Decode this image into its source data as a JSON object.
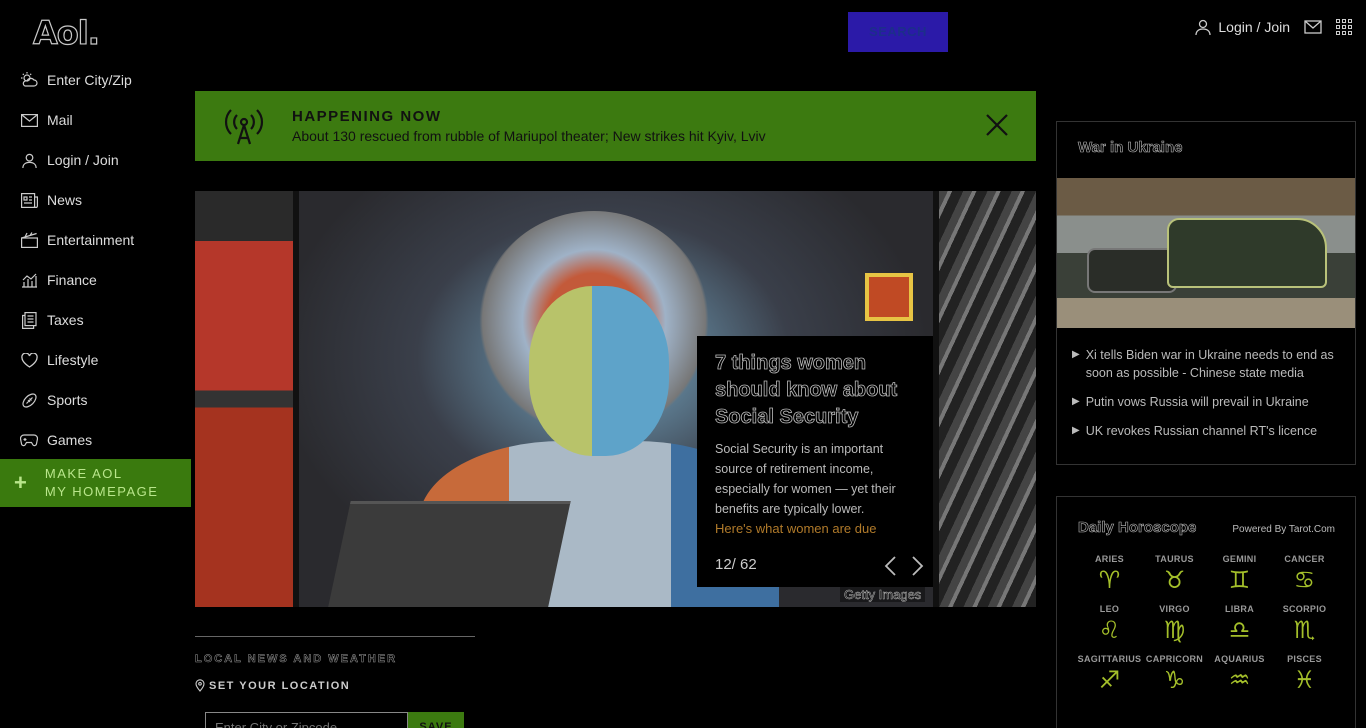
{
  "header": {
    "logo": "Aol.",
    "search_label": "SEARCH",
    "login_label": "Login / Join"
  },
  "sidebar": {
    "items": [
      {
        "label": "Enter City/Zip",
        "icon": "weather-icon"
      },
      {
        "label": "Mail",
        "icon": "mail-icon"
      },
      {
        "label": "Login / Join",
        "icon": "user-icon"
      },
      {
        "label": "News",
        "icon": "news-icon"
      },
      {
        "label": "Entertainment",
        "icon": "clapper-icon"
      },
      {
        "label": "Finance",
        "icon": "chart-icon"
      },
      {
        "label": "Taxes",
        "icon": "document-icon"
      },
      {
        "label": "Lifestyle",
        "icon": "heart-icon"
      },
      {
        "label": "Sports",
        "icon": "football-icon"
      },
      {
        "label": "Games",
        "icon": "gamepad-icon"
      }
    ],
    "make_homepage_line1": "MAKE AOL",
    "make_homepage_line2": "MY HOMEPAGE"
  },
  "happening": {
    "title": "HAPPENING NOW",
    "text": "About 130 rescued from rubble of Mariupol theater; New strikes hit Kyiv, Lviv"
  },
  "slide": {
    "headline": "7 things women should know about Social Security",
    "description": "Social Security is an important source of retirement income, especially for women — yet their benefits are typically lower.",
    "more_link": "Here's what women are due",
    "counter": "12/ 62",
    "credit": "Getty Images"
  },
  "local": {
    "title": "LOCAL NEWS AND WEATHER",
    "set_location": "SET YOUR LOCATION",
    "input_placeholder": "Enter City or Zipcode",
    "save_label": "SAVE"
  },
  "ukraine": {
    "title": "War in Ukraine",
    "items": [
      "Xi tells Biden war in Ukraine needs to end as soon as possible - Chinese state media",
      "Putin vows Russia will prevail in Ukraine",
      "UK revokes Russian channel RT's licence"
    ]
  },
  "horoscope": {
    "title": "Daily Horoscope",
    "powered_by": "Powered By Tarot.Com",
    "signs": [
      {
        "name": "ARIES",
        "glyph": "♈"
      },
      {
        "name": "TAURUS",
        "glyph": "♉"
      },
      {
        "name": "GEMINI",
        "glyph": "♊"
      },
      {
        "name": "CANCER",
        "glyph": "♋"
      },
      {
        "name": "LEO",
        "glyph": "♌"
      },
      {
        "name": "VIRGO",
        "glyph": "♍"
      },
      {
        "name": "LIBRA",
        "glyph": "♎"
      },
      {
        "name": "SCORPIO",
        "glyph": "♏"
      },
      {
        "name": "SAGITTARIUS",
        "glyph": "♐"
      },
      {
        "name": "CAPRICORN",
        "glyph": "♑"
      },
      {
        "name": "AQUARIUS",
        "glyph": "♒"
      },
      {
        "name": "PISCES",
        "glyph": "♓"
      }
    ]
  },
  "colors": {
    "accent_green": "#3c7a10",
    "search_blue": "#2b1aa8",
    "horoscope_glyph": "#a4bf2a"
  }
}
